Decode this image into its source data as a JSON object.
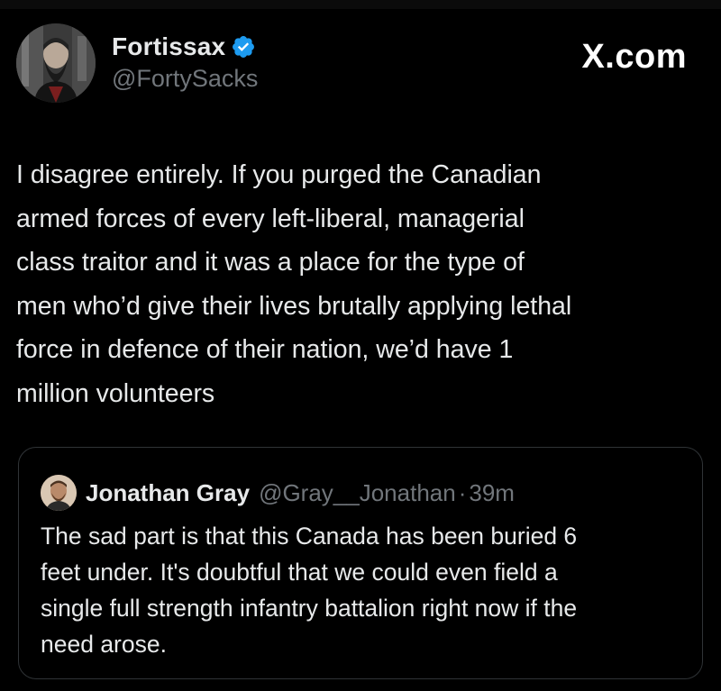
{
  "post": {
    "author": {
      "display_name": "Fortissax",
      "handle": "@FortySacks",
      "verified": true,
      "avatar_icon": "profile-photo-bearded-man"
    },
    "brand": "X.com",
    "text_lines": [
      "I disagree entirely. If you purged the Canadian",
      "armed forces of every left-liberal, managerial",
      "class traitor and it was a place for the type of",
      "men who’d give their lives brutally applying lethal",
      "force in defence of their nation, we’d have 1",
      "million volunteers"
    ]
  },
  "quoted_post": {
    "author": {
      "display_name": "Jonathan Gray",
      "handle": "@Gray__Jonathan",
      "avatar_icon": "profile-photo-man"
    },
    "separator": "·",
    "time": "39m",
    "text_lines": [
      "The sad part is that this Canada has been buried 6",
      "feet under.  It's doubtful that we could even field a",
      "single full strength infantry battalion right now if the",
      "need arose."
    ]
  },
  "colors": {
    "background": "#000000",
    "text_primary": "#e7e9ea",
    "text_secondary": "#71767b",
    "verified_badge": "#1d9bf0",
    "quote_border": "#2f3336"
  }
}
